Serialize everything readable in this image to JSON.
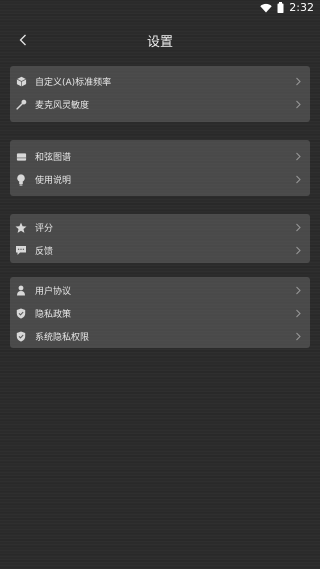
{
  "status_bar": {
    "time": "2:32"
  },
  "header": {
    "title": "设置"
  },
  "groups": [
    {
      "items": [
        {
          "label": "自定义(A)标准频率",
          "icon": "cube-icon"
        },
        {
          "label": "麦克风灵敏度",
          "icon": "microphone-icon"
        }
      ]
    },
    {
      "items": [
        {
          "label": "和弦图谱",
          "icon": "chord-chart-icon"
        },
        {
          "label": "使用说明",
          "icon": "lightbulb-icon"
        }
      ]
    },
    {
      "items": [
        {
          "label": "评分",
          "icon": "star-icon"
        },
        {
          "label": "反馈",
          "icon": "chat-icon"
        }
      ]
    },
    {
      "items": [
        {
          "label": "用户协议",
          "icon": "user-icon"
        },
        {
          "label": "隐私政策",
          "icon": "shield-icon"
        },
        {
          "label": "系统隐私权限",
          "icon": "shield-icon"
        }
      ]
    }
  ]
}
